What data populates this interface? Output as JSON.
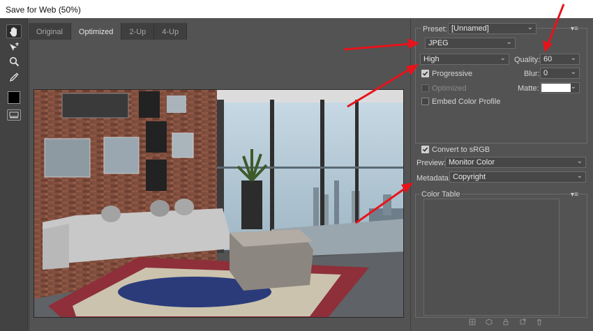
{
  "window": {
    "title": "Save for Web (50%)"
  },
  "tabs": [
    {
      "label": "Original",
      "active": false
    },
    {
      "label": "Optimized",
      "active": true
    },
    {
      "label": "2-Up",
      "active": false
    },
    {
      "label": "4-Up",
      "active": false
    }
  ],
  "tools": [
    "hand-tool",
    "slice-select-tool",
    "zoom-tool",
    "eyedropper-tool"
  ],
  "eyedropper_color": "#000000",
  "preset": {
    "label": "Preset:",
    "value": "[Unnamed]"
  },
  "format": {
    "value": "JPEG"
  },
  "compression": {
    "value": "High"
  },
  "quality": {
    "label": "Quality:",
    "value": "60"
  },
  "progressive": {
    "label": "Progressive",
    "checked": true
  },
  "blur": {
    "label": "Blur:",
    "value": "0"
  },
  "optimized": {
    "label": "Optimized",
    "checked": false,
    "enabled": false
  },
  "matte": {
    "label": "Matte:",
    "color": "#ffffff"
  },
  "embed_profile": {
    "label": "Embed Color Profile",
    "checked": false
  },
  "convert_srgb": {
    "label": "Convert to sRGB",
    "checked": true
  },
  "preview": {
    "label": "Preview:",
    "value": "Monitor Color"
  },
  "metadata": {
    "label": "Metadata:",
    "value": "Copyright"
  },
  "color_table": {
    "title": "Color Table"
  },
  "annotation_color": "#e8141b"
}
